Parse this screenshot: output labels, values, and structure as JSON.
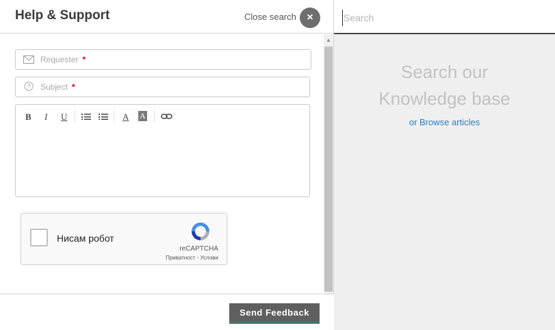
{
  "header": {
    "title": "Help & Support",
    "close_search_label": "Close search",
    "close_icon": "×"
  },
  "form": {
    "requester_placeholder": "Requester",
    "subject_placeholder": "Subject",
    "required_marker": "*",
    "editor_toolbar": {
      "bold": "B",
      "italic": "I",
      "underline": "U",
      "font_color": "A",
      "bg_color": "A"
    }
  },
  "captcha": {
    "label": "Нисам робот",
    "brand": "reCAPTCHA",
    "links": "Приватност - Услови"
  },
  "footer": {
    "send_label": "Send Feedback"
  },
  "search": {
    "placeholder": "Search",
    "kb_line1": "Search our",
    "kb_line2": "Knowledge base",
    "browse_link": "or Browse articles"
  },
  "colors": {
    "link": "#2a7ec4",
    "button": "#5f5f5f",
    "required": "#cc0000"
  }
}
